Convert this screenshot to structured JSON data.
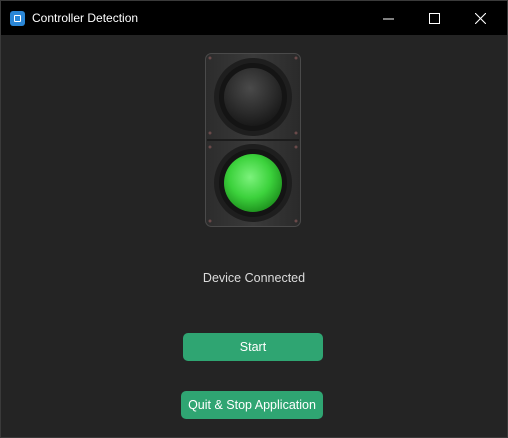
{
  "window": {
    "title": "Controller Detection"
  },
  "traffic_light": {
    "top_light": "off",
    "bottom_light": "on",
    "active_color": "#3cd23c"
  },
  "status": {
    "text": "Device Connected"
  },
  "buttons": {
    "start_label": "Start",
    "quit_label": "Quit & Stop Application"
  },
  "colors": {
    "accent": "#2fa572",
    "background": "#242424",
    "titlebar": "#000000"
  }
}
